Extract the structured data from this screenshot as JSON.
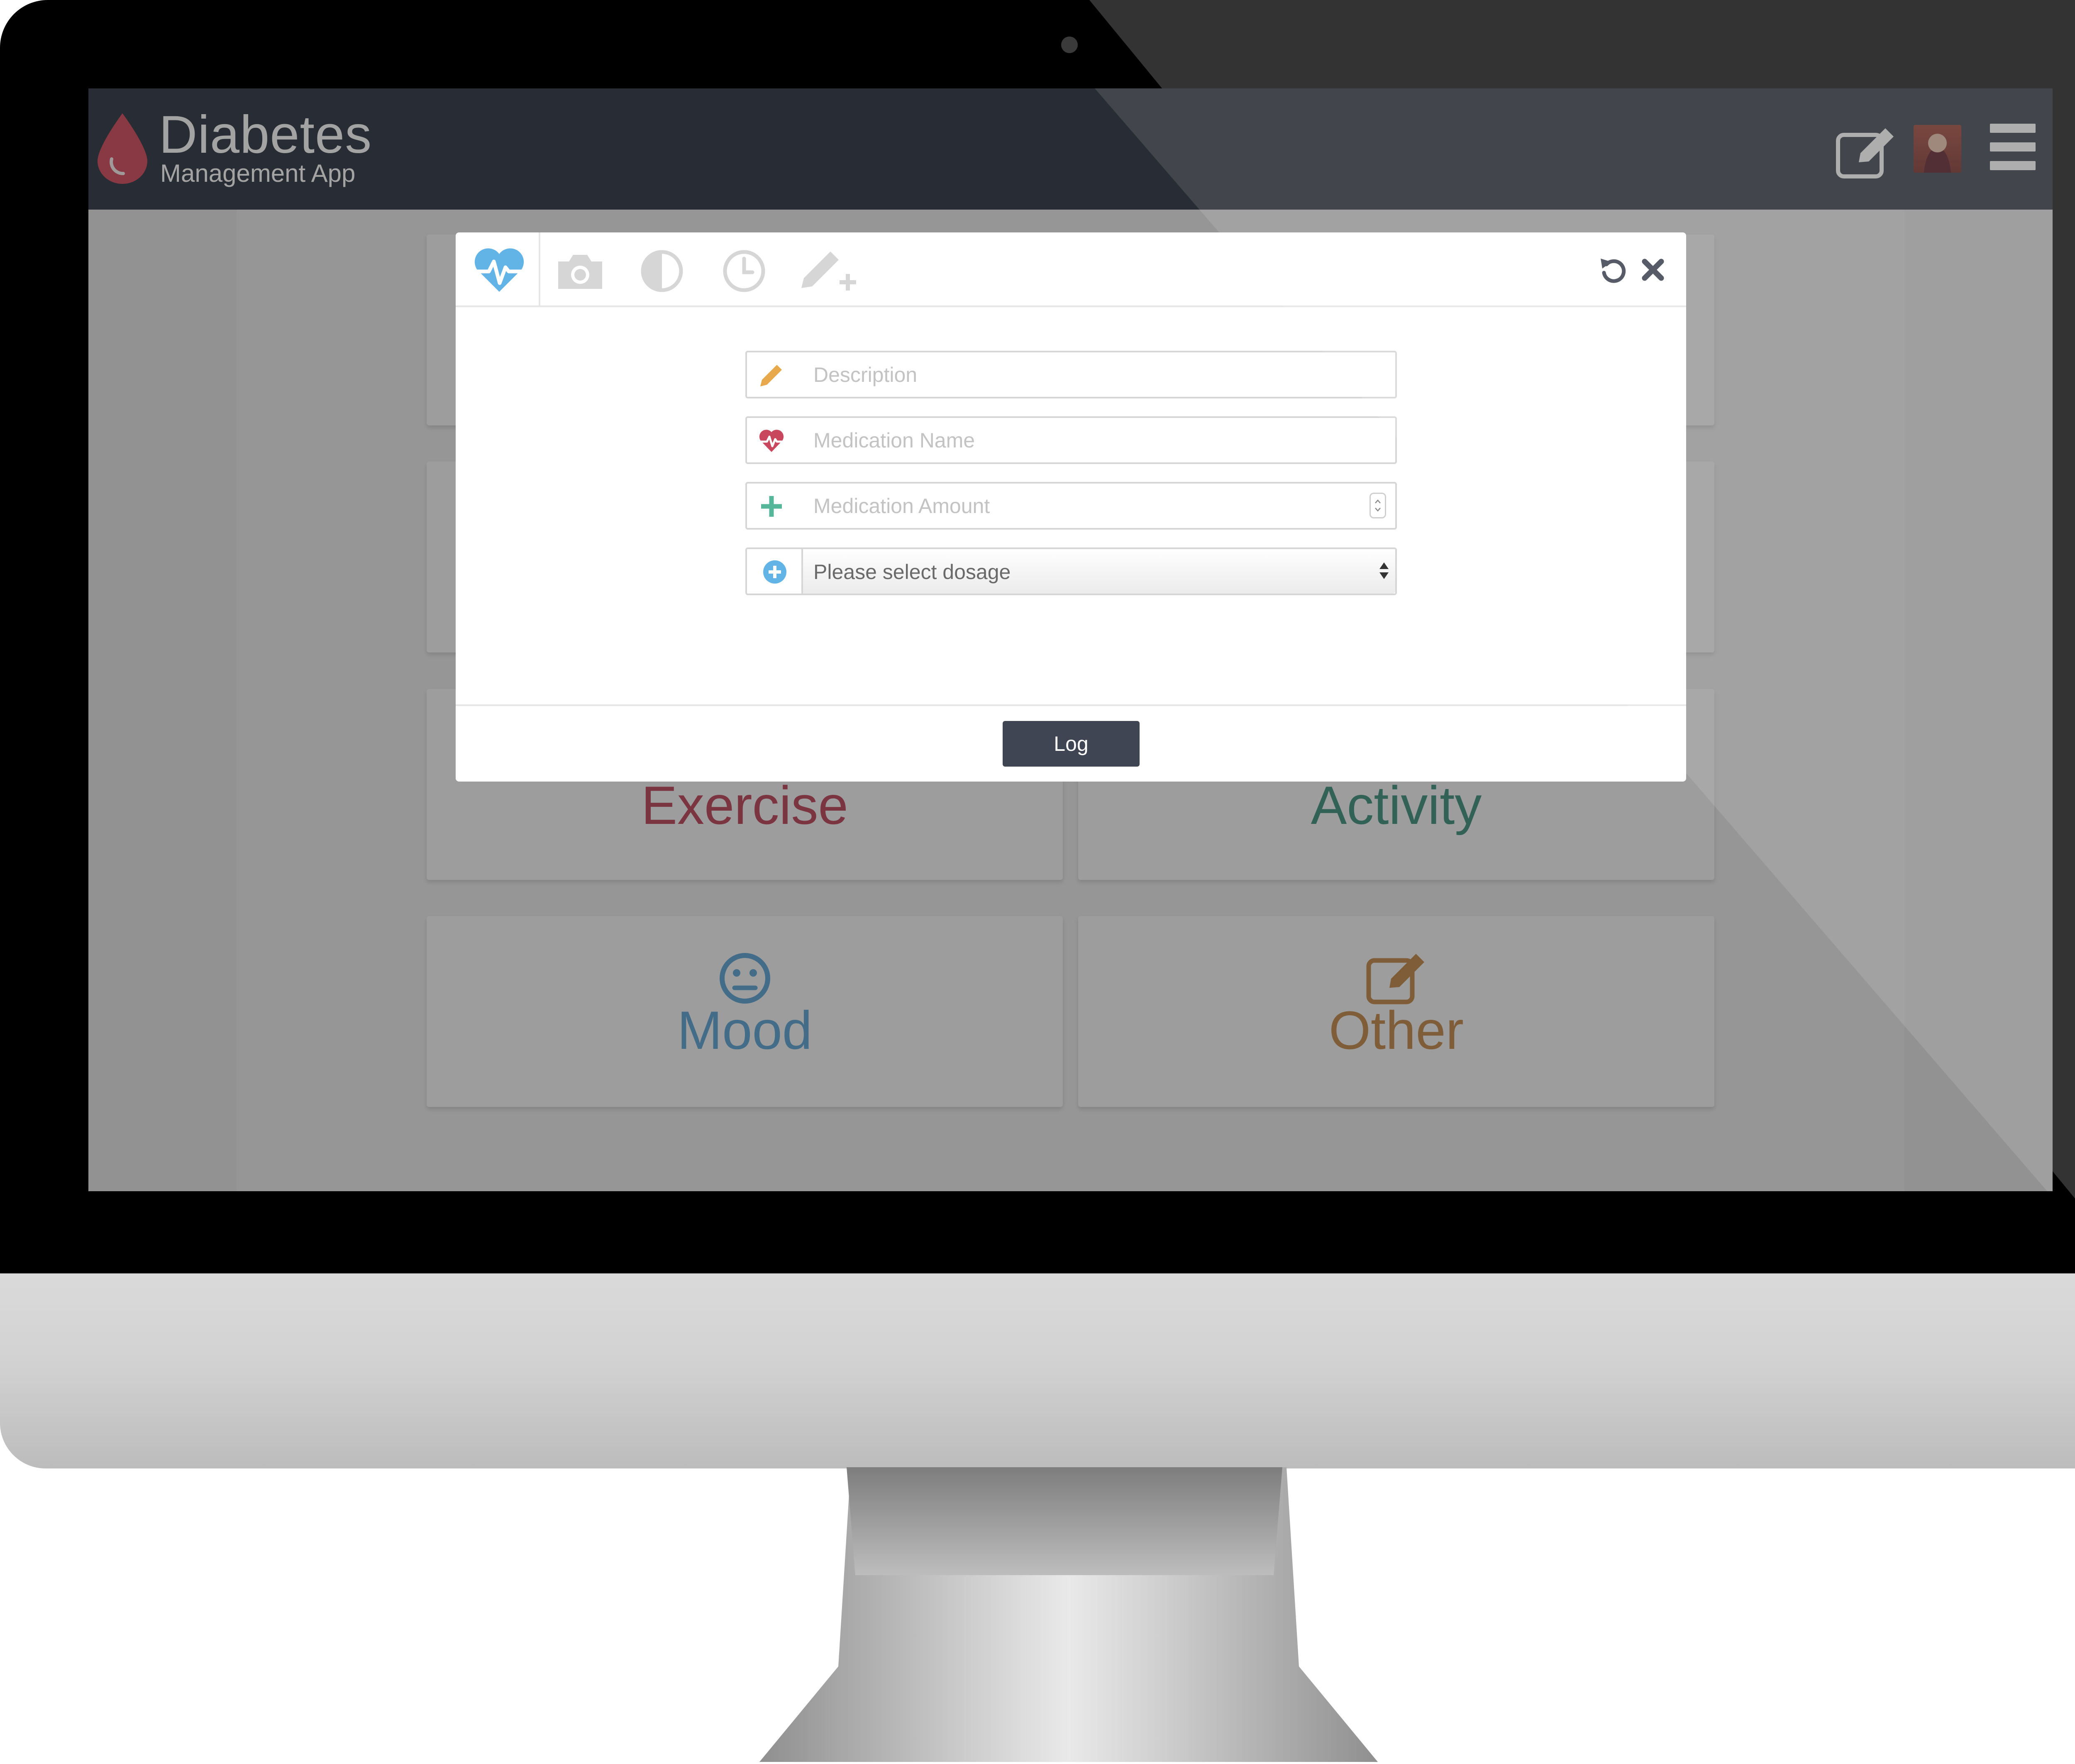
{
  "app": {
    "brand_title": "Diabetes",
    "brand_subtitle": "Management App",
    "accent_color": "#d5596a",
    "header_color": "#3f4552"
  },
  "header": {
    "icons": [
      "edit-icon",
      "avatar",
      "hamburger-menu-icon"
    ]
  },
  "tiles": [
    {
      "label": "Exercise",
      "color": "#c05466"
    },
    {
      "label": "Activity",
      "color": "#4f9a86"
    },
    {
      "label": "Mood",
      "color": "#6aa9d6",
      "icon": "neutral-face-icon"
    },
    {
      "label": "Other",
      "color": "#c7925a",
      "icon": "edit-icon"
    }
  ],
  "modal": {
    "tabs": [
      "heartbeat-icon",
      "camera-icon",
      "contrast-icon",
      "clock-icon",
      "pencil-plus-icon"
    ],
    "active_tab": "heartbeat-icon",
    "fields": {
      "description": {
        "placeholder": "Description",
        "icon": "pencil-icon"
      },
      "medication_name": {
        "placeholder": "Medication Name",
        "icon": "heartbeat-icon"
      },
      "medication_amount": {
        "placeholder": "Medication Amount",
        "icon": "plus-icon"
      },
      "dosage": {
        "selected": "Please select dosage",
        "icon": "plus-circle-icon"
      }
    },
    "log_label": "Log"
  }
}
